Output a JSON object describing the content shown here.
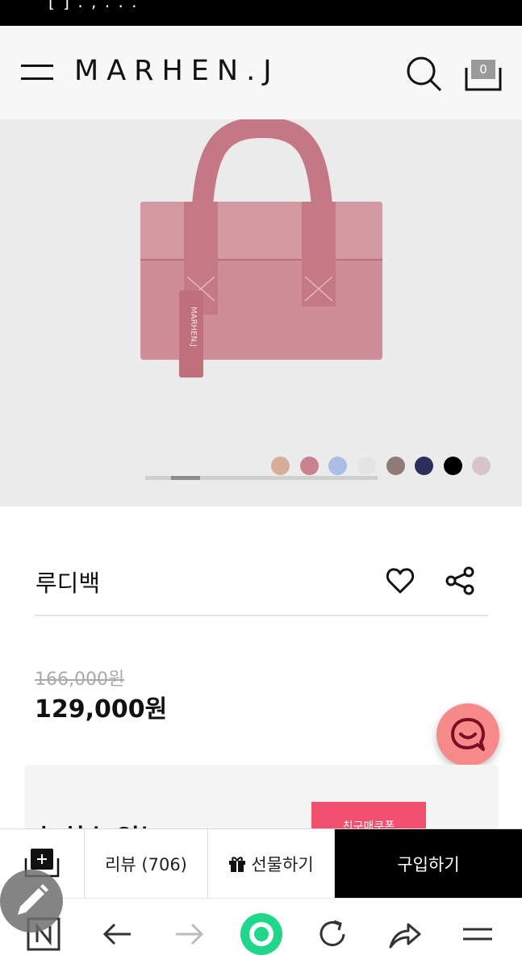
{
  "status_bar": {
    "text": "[ ] . , . . ."
  },
  "header": {
    "logo": "MARHEN.J",
    "cart_count": "0"
  },
  "gallery": {
    "swatches": [
      "#d4ae98",
      "#c8828f",
      "#a9bde6",
      "#e4e4e4",
      "#8f7a74",
      "#2b2f5a",
      "#000000",
      "#d6c3cb"
    ],
    "slider_position": 0.125
  },
  "product": {
    "title": "루디백",
    "original_price": "166,000원",
    "sale_price": "129,000원"
  },
  "promo": {
    "heading": "놓치수 없는",
    "badge": "친구매쿠폰"
  },
  "actions": {
    "review": "리뷰 (706)",
    "gift": "선물하기",
    "buy": "구입하기"
  },
  "colors": {
    "accent_pink": "#f7898a",
    "buy_button": "#000000",
    "promo_badge": "#f0506e",
    "browser_green": "#1fd68a"
  },
  "icons": {
    "header": [
      "menu-icon",
      "search-icon",
      "cart-icon"
    ],
    "product": [
      "heart-icon",
      "share-icon"
    ],
    "browser": [
      "naver-icon",
      "back-icon",
      "forward-icon",
      "home-icon",
      "refresh-icon",
      "share-icon",
      "menu-icon"
    ]
  }
}
